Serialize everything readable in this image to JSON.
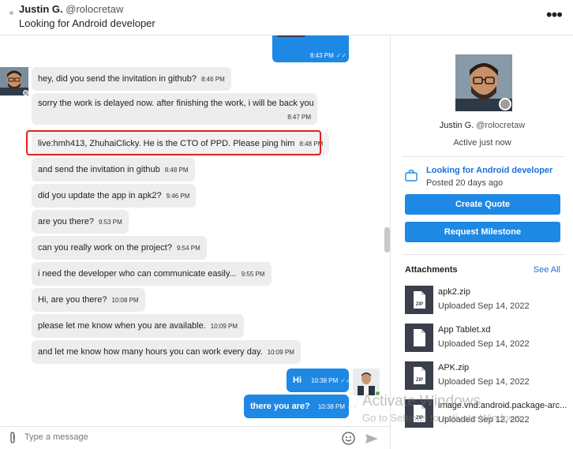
{
  "header": {
    "name": "Justin G.",
    "handle": "@rolocretaw",
    "subject": "Looking for Android developer",
    "more_icon": "more-horizontal-icon"
  },
  "messages": [
    {
      "dir": "out",
      "text": "",
      "time": "8:43 PM"
    },
    {
      "dir": "in",
      "text": "hey, did you send the invitation in github?",
      "time": "8:46 PM"
    },
    {
      "dir": "in",
      "text": "sorry the work is delayed now. after finishing the work, i will be back you",
      "time": "8:47 PM"
    },
    {
      "dir": "in",
      "text": "live:hmh413, ZhuhaiClicky. He is the CTO of PPD. Please ping him",
      "time": "8:48 PM"
    },
    {
      "dir": "in",
      "text": "and send the invitation in github",
      "time": "8:48 PM"
    },
    {
      "dir": "in",
      "text": "did you update the app in apk2?",
      "time": "9:46 PM"
    },
    {
      "dir": "in",
      "text": "are you there?",
      "time": "9:53 PM"
    },
    {
      "dir": "in",
      "text": "can you really work on the project?",
      "time": "9:54 PM"
    },
    {
      "dir": "in",
      "text": "i need the developer who can communicate easily...",
      "time": "9:55 PM"
    },
    {
      "dir": "in",
      "text": "Hi, are you there?",
      "time": "10:08 PM"
    },
    {
      "dir": "in",
      "text": "please let me know when you are available.",
      "time": "10:09 PM"
    },
    {
      "dir": "in",
      "text": "and let me know how many hours you can work every day.",
      "time": "10:09 PM"
    },
    {
      "dir": "out",
      "text": "Hi",
      "time": "10:38 PM"
    },
    {
      "dir": "out",
      "text": "there you are?",
      "time": "10:38 PM"
    }
  ],
  "composer": {
    "placeholder": "Type a message",
    "attach_icon": "paperclip-icon",
    "emoji_icon": "emoji-icon",
    "send_icon": "send-icon"
  },
  "profile": {
    "name": "Justin G.",
    "handle": "@rolocretaw",
    "status": "Active just now",
    "project_title": "Looking for Android developer",
    "project_posted": "Posted 20 days ago",
    "create_quote": "Create Quote",
    "request_milestone": "Request Milestone"
  },
  "attachments": {
    "title": "Attachments",
    "see_all": "See All",
    "files": [
      {
        "name": "apk2.zip",
        "date": "Uploaded Sep 14, 2022",
        "icon": "zip-file-icon"
      },
      {
        "name": "App Tablet.xd",
        "date": "Uploaded Sep 14, 2022",
        "icon": "file-icon"
      },
      {
        "name": "APK.zip",
        "date": "Uploaded Sep 14, 2022",
        "icon": "zip-file-icon"
      },
      {
        "name": "image.vnd.android.package-arc...",
        "date": "Uploaded Sep 12, 2022",
        "icon": "zip-file-icon"
      }
    ]
  },
  "watermark": {
    "line1": "Activate Windows",
    "line2": "Go to Settings to activate Windows."
  },
  "colors": {
    "accent": "#1e88e5",
    "link": "#1e6fd9",
    "incoming_bubble": "#ededed",
    "highlight_border": "#e02020"
  }
}
